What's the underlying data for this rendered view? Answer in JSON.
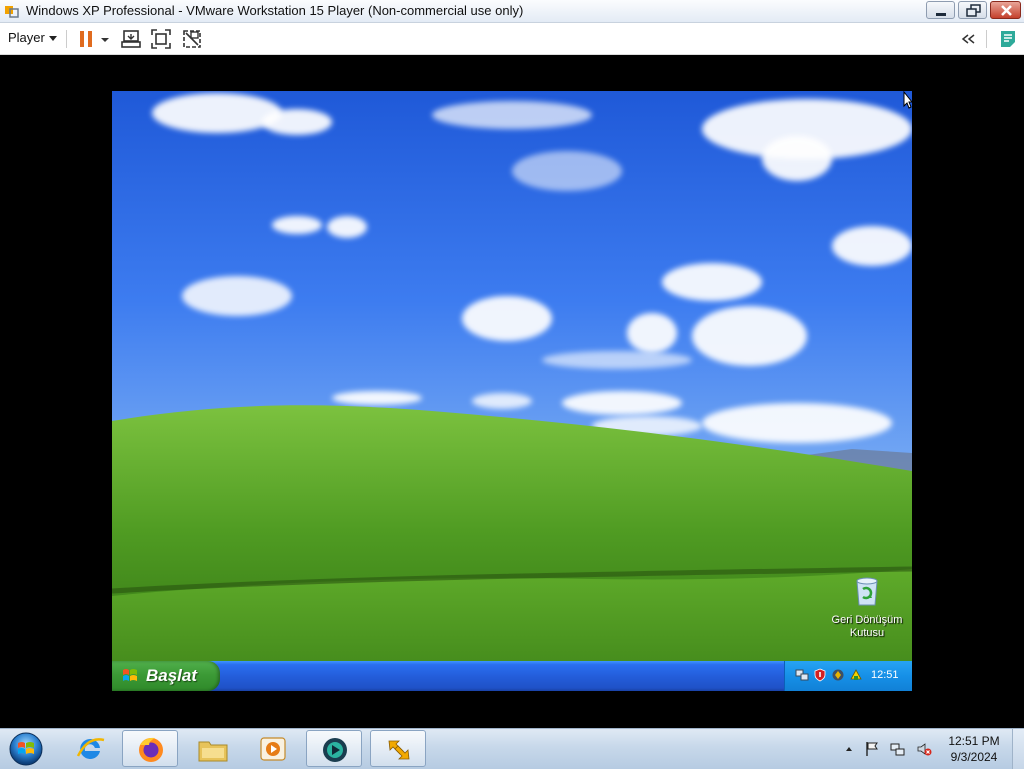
{
  "window": {
    "title": "Windows XP Professional - VMware Workstation 15 Player (Non-commercial use only)",
    "controls": [
      "minimize-icon",
      "restore-icon",
      "close-icon"
    ]
  },
  "toolbar": {
    "player_label": "Player",
    "icons": [
      "pause-icon",
      "dropdown-arrow-icon",
      "send-ctrl-alt-del-icon",
      "fullscreen-icon",
      "unity-icon",
      "collapse-chevrons-icon",
      "notes-icon"
    ],
    "accent": "#e06b1f"
  },
  "guest": {
    "desktop_icons": [
      {
        "label": "Geri Dönüşüm Kutusu",
        "icon": "recycle-bin-icon"
      }
    ],
    "taskbar": {
      "start_label": "Başlat",
      "clock": "12:51",
      "tray_icons": [
        "network-icon",
        "security-alert-icon",
        "antivirus-icon",
        "update-icon"
      ]
    },
    "colors": {
      "taskbar": "#245edb",
      "start": "#3c9a36",
      "tray": "#1690e7"
    }
  },
  "host_taskbar": {
    "pinned": [
      {
        "icon": "internet-explorer-icon",
        "active": false
      },
      {
        "icon": "firefox-icon",
        "active": true
      },
      {
        "icon": "file-explorer-icon",
        "active": false
      },
      {
        "icon": "media-player-icon",
        "active": false
      },
      {
        "icon": "vmware-player-icon",
        "active": true
      },
      {
        "icon": "app-arrows-icon",
        "active": true
      }
    ],
    "tray_icons": [
      "show-hidden-icons-icon",
      "action-center-flag-icon",
      "network-icon",
      "volume-muted-icon"
    ],
    "clock": {
      "time": "12:51 PM",
      "date": "9/3/2024"
    }
  }
}
